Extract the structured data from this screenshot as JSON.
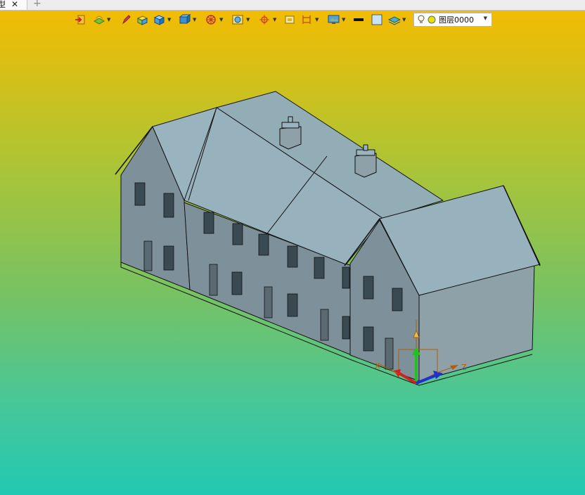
{
  "tab": {
    "label": "型",
    "close": "✕",
    "add": "+"
  },
  "toolbar": {
    "items": [
      "exit-icon",
      "layer-manager-icon",
      "pen-icon",
      "solid-box-icon",
      "cube-icon",
      "view-cube-icon",
      "render-wheel-icon",
      "display-mode-icon",
      "snap-icon",
      "frame-icon",
      "dimension-icon",
      "screen-icon",
      "line-weight-icon",
      "color-icon",
      "layer-stack-icon"
    ]
  },
  "layer": {
    "name": "图层0000",
    "bulb": "lightbulb-icon",
    "color": "#e8e200"
  },
  "axes": {
    "x_label": "X",
    "z_label": "Z"
  },
  "colors": {
    "wall": "#7e919a",
    "roof": "#93adb7",
    "outline": "#111111"
  }
}
